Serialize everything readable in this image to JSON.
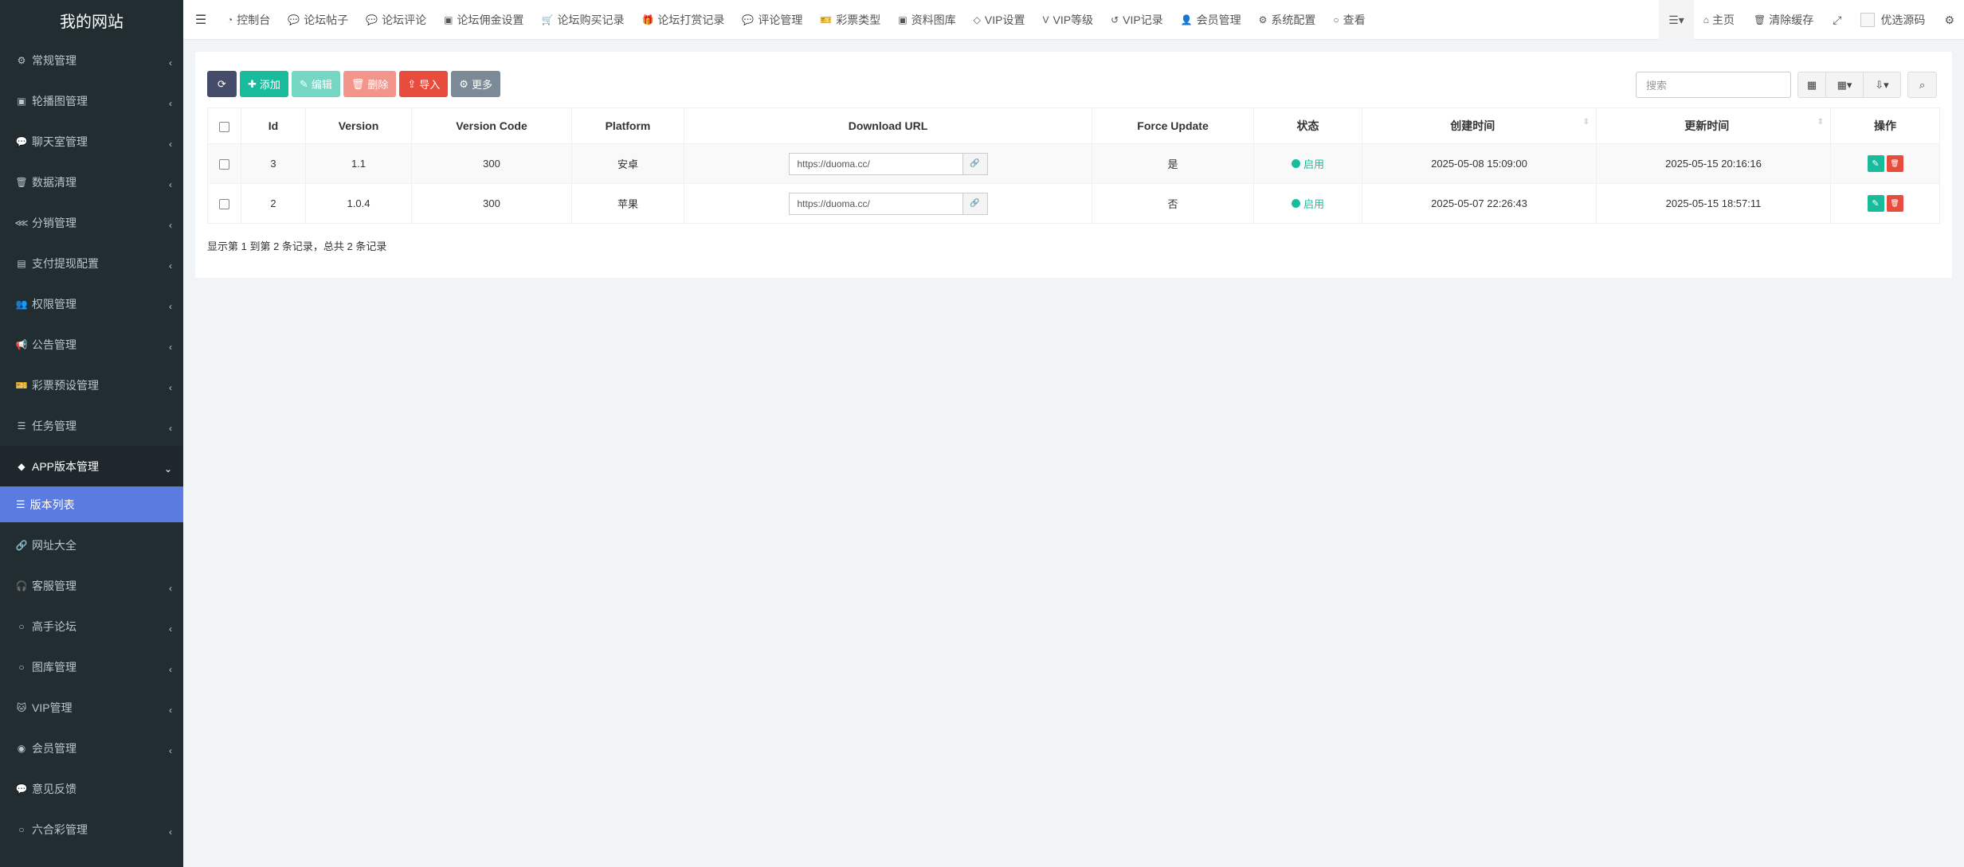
{
  "site_title": "我的网站",
  "sidebar": {
    "items": [
      {
        "label": "常规管理",
        "icon": "cogs-icon",
        "glyph": "⚙"
      },
      {
        "label": "轮播图管理",
        "icon": "image-icon",
        "glyph": "▣"
      },
      {
        "label": "聊天室管理",
        "icon": "comments-icon",
        "glyph": "💬"
      },
      {
        "label": "数据清理",
        "icon": "trash-icon",
        "glyph": "🗑"
      },
      {
        "label": "分销管理",
        "icon": "share-icon",
        "glyph": "⋘"
      },
      {
        "label": "支付提现配置",
        "icon": "money-icon",
        "glyph": "▤"
      },
      {
        "label": "权限管理",
        "icon": "group-icon",
        "glyph": "👥"
      },
      {
        "label": "公告管理",
        "icon": "bullhorn-icon",
        "glyph": "📢"
      },
      {
        "label": "彩票预设管理",
        "icon": "ticket-icon",
        "glyph": "🎫"
      },
      {
        "label": "任务管理",
        "icon": "list-icon",
        "glyph": "☰"
      },
      {
        "label": "APP版本管理",
        "icon": "android-icon",
        "glyph": "◆"
      }
    ],
    "sub_item": {
      "label": "版本列表",
      "icon": "list-icon",
      "glyph": "☰"
    },
    "items_after": [
      {
        "label": "网址大全",
        "icon": "link-icon",
        "glyph": "🔗"
      },
      {
        "label": "客服管理",
        "icon": "headphones-icon",
        "glyph": "🎧"
      },
      {
        "label": "高手论坛",
        "icon": "circle-icon",
        "glyph": "○"
      },
      {
        "label": "图库管理",
        "icon": "circle-icon",
        "glyph": "○"
      },
      {
        "label": "VIP管理",
        "icon": "github-icon",
        "glyph": "🐱"
      },
      {
        "label": "会员管理",
        "icon": "user-circle-icon",
        "glyph": "◉"
      },
      {
        "label": "意见反馈",
        "icon": "comment-icon",
        "glyph": "💬"
      },
      {
        "label": "六合彩管理",
        "icon": "circle-icon",
        "glyph": "○"
      }
    ]
  },
  "topnav": {
    "links": [
      {
        "label": "控制台",
        "icon": "dashboard-icon",
        "glyph": "◔"
      },
      {
        "label": "论坛帖子",
        "icon": "comment-icon",
        "glyph": "💬"
      },
      {
        "label": "论坛评论",
        "icon": "comments-icon",
        "glyph": "💬"
      },
      {
        "label": "论坛佣金设置",
        "icon": "money-icon",
        "glyph": "▣"
      },
      {
        "label": "论坛购买记录",
        "icon": "cart-icon",
        "glyph": "🛒"
      },
      {
        "label": "论坛打赏记录",
        "icon": "gift-icon",
        "glyph": "🎁"
      },
      {
        "label": "评论管理",
        "icon": "comments-icon",
        "glyph": "💬"
      },
      {
        "label": "彩票类型",
        "icon": "ticket-icon",
        "glyph": "🎫"
      },
      {
        "label": "资料图库",
        "icon": "image-icon",
        "glyph": "▣"
      },
      {
        "label": "VIP设置",
        "icon": "diamond-icon",
        "glyph": "◇"
      },
      {
        "label": "VIP等级",
        "icon": "vimeo-icon",
        "glyph": "V"
      },
      {
        "label": "VIP记录",
        "icon": "history-icon",
        "glyph": "↺"
      },
      {
        "label": "会员管理",
        "icon": "user-icon",
        "glyph": "👤"
      },
      {
        "label": "系统配置",
        "icon": "cog-icon",
        "glyph": "⚙"
      },
      {
        "label": "查看",
        "icon": "circle-icon",
        "glyph": "○"
      }
    ],
    "right": {
      "home": "主页",
      "clear_cache": "清除缓存",
      "user": "优选源码"
    }
  },
  "toolbar": {
    "add": "添加",
    "edit": "编辑",
    "delete": "删除",
    "import": "导入",
    "more": "更多"
  },
  "search": {
    "placeholder": "搜索"
  },
  "table": {
    "headers": {
      "id": "Id",
      "version": "Version",
      "version_code": "Version Code",
      "platform": "Platform",
      "download_url": "Download URL",
      "force_update": "Force Update",
      "status": "状态",
      "created": "创建时间",
      "updated": "更新时间",
      "ops": "操作"
    },
    "rows": [
      {
        "id": "3",
        "version": "1.1",
        "version_code": "300",
        "platform": "安卓",
        "platform_colored": false,
        "url": "https://duoma.cc/",
        "force_update": "是",
        "force_colored": true,
        "status": "启用",
        "created": "2025-05-08 15:09:00",
        "updated": "2025-05-15 20:16:16"
      },
      {
        "id": "2",
        "version": "1.0.4",
        "version_code": "300",
        "platform": "苹果",
        "platform_colored": true,
        "url": "https://duoma.cc/",
        "force_update": "否",
        "force_colored": false,
        "status": "启用",
        "created": "2025-05-07 22:26:43",
        "updated": "2025-05-15 18:57:11"
      }
    ]
  },
  "pagination_info": "显示第 1 到第 2 条记录，总共 2 条记录",
  "colors": {
    "accent": "#18bc9c",
    "sidebar": "#222d32",
    "active_sub": "#5b7be0",
    "danger": "#e74c3c"
  }
}
